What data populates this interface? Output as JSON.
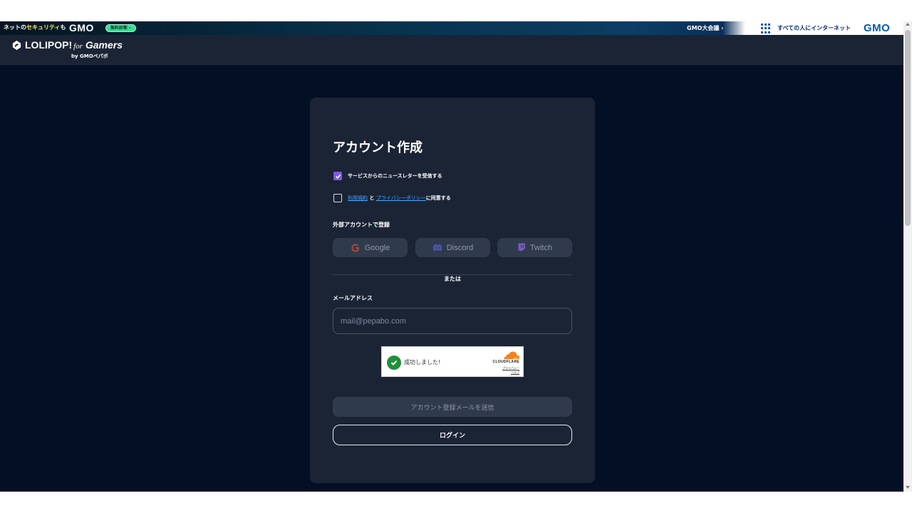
{
  "gmo_bar": {
    "left_text_prefix": "ネットの",
    "left_text_highlight": "セキュリティ",
    "left_text_suffix": "も",
    "logo_left": "GMO",
    "free_check_button": "無料診断 ›",
    "taikai_link": "GMO大会議 ›",
    "tagline": "すべての人にインターネット",
    "logo_right": "GMO",
    "colors": {
      "bar_dark": "#041522",
      "logo_blue": "#005bac",
      "free_button": "#3ddc97"
    }
  },
  "header": {
    "brand_main": "LOLIPOP!",
    "brand_for": "for",
    "brand_gamers": "Gamers",
    "brand_sub": "by GMOペパボ"
  },
  "card": {
    "title": "アカウント作成",
    "newsletter": {
      "checked": true,
      "label": "サービスからのニュースレターを受信する"
    },
    "terms": {
      "checked": false,
      "terms_link": "利用規約",
      "and": " と ",
      "privacy_link": "プライバシーポリシー",
      "suffix": "に同意する"
    },
    "external_label": "外部アカウントで登録",
    "social": {
      "google": "Google",
      "discord": "Discord",
      "twitch": "Twitch"
    },
    "or_text": "または",
    "email_label": "メールアドレス",
    "email_placeholder": "mail@pepabo.com",
    "email_value": "",
    "turnstile": {
      "status": "成功しました!",
      "brand": "CLOUDFLARE",
      "privacy": "プライバシー",
      "help": "ヘルプ"
    },
    "submit_button": "アカウント登録メールを送信",
    "login_button": "ログイン"
  },
  "colors": {
    "page_bg": "#030f24",
    "card_bg": "#1a2435",
    "accent_purple": "#7c5ce0",
    "link_blue": "#4aa3ff",
    "button_disabled": "#2f3a4c"
  }
}
